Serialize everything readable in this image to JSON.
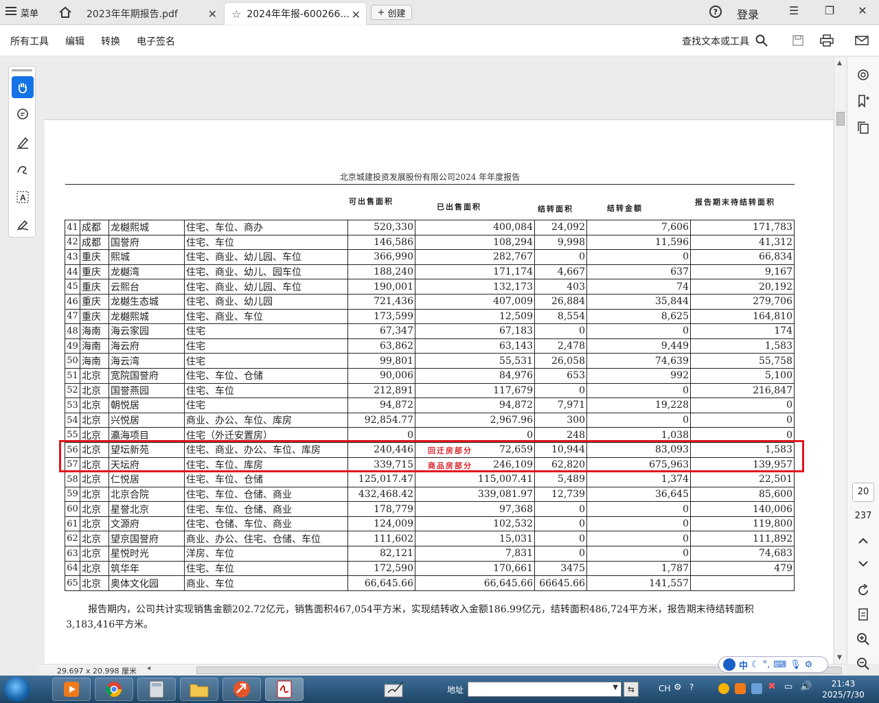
{
  "tabbar": {
    "menu_label": "菜单",
    "tabs": [
      {
        "label": "2023年年期报告.pdf"
      },
      {
        "label": "2024年年报-600266..."
      }
    ],
    "create_label": "创建",
    "login_label": "登录"
  },
  "toolbar": {
    "items": [
      "所有工具",
      "编辑",
      "转换",
      "电子签名"
    ],
    "find_label": "查找文本或工具"
  },
  "document": {
    "header": "北京城建投资发展股份有限公司2024 年年度报告",
    "columns": {
      "avail": "可出售面积",
      "sold": "已出售面积",
      "carry_area": "结转面积",
      "carry_amount": "结转金额",
      "end_area": "报告期末待结转面积"
    },
    "rows": [
      {
        "idx": "41",
        "city": "成都",
        "name": "龙樾熙城",
        "type": "住宅、车位、商办",
        "avail": "520,330",
        "sold": "400,084",
        "carea": "24,092",
        "camt": "7,606",
        "end": "171,783",
        "note": ""
      },
      {
        "idx": "42",
        "city": "成都",
        "name": "国誉府",
        "type": "住宅、车位",
        "avail": "146,586",
        "sold": "108,294",
        "carea": "9,998",
        "camt": "11,596",
        "end": "41,312",
        "note": ""
      },
      {
        "idx": "43",
        "city": "重庆",
        "name": "熙城",
        "type": "住宅、商业、幼儿园、车位",
        "avail": "366,990",
        "sold": "282,767",
        "carea": "0",
        "camt": "0",
        "end": "66,834",
        "note": ""
      },
      {
        "idx": "44",
        "city": "重庆",
        "name": "龙樾湾",
        "type": "住宅、商业、幼儿、园车位",
        "avail": "188,240",
        "sold": "171,174",
        "carea": "4,667",
        "camt": "637",
        "end": "9,167",
        "note": ""
      },
      {
        "idx": "45",
        "city": "重庆",
        "name": "云熙台",
        "type": "住宅、商业、幼儿园、车位",
        "avail": "190,001",
        "sold": "132,173",
        "carea": "403",
        "camt": "74",
        "end": "20,192",
        "note": ""
      },
      {
        "idx": "46",
        "city": "重庆",
        "name": "龙樾生态城",
        "type": "住宅、商业、幼儿园",
        "avail": "721,436",
        "sold": "407,009",
        "carea": "26,884",
        "camt": "35,844",
        "end": "279,706",
        "note": ""
      },
      {
        "idx": "47",
        "city": "重庆",
        "name": "龙樾熙城",
        "type": "住宅、商业、车位",
        "avail": "173,599",
        "sold": "12,509",
        "carea": "8,554",
        "camt": "8,625",
        "end": "164,810",
        "note": ""
      },
      {
        "idx": "48",
        "city": "海南",
        "name": "海云家园",
        "type": "住宅",
        "avail": "67,347",
        "sold": "67,183",
        "carea": "0",
        "camt": "0",
        "end": "174",
        "note": ""
      },
      {
        "idx": "49",
        "city": "海南",
        "name": "海云府",
        "type": "住宅",
        "avail": "63,862",
        "sold": "63,143",
        "carea": "2,478",
        "camt": "9,449",
        "end": "1,583",
        "note": ""
      },
      {
        "idx": "50",
        "city": "海南",
        "name": "海云湾",
        "type": "住宅",
        "avail": "99,801",
        "sold": "55,531",
        "carea": "26,058",
        "camt": "74,639",
        "end": "55,758",
        "note": ""
      },
      {
        "idx": "51",
        "city": "北京",
        "name": "宽院国誉府",
        "type": "住宅、车位、仓储",
        "avail": "90,006",
        "sold": "84,976",
        "carea": "653",
        "camt": "992",
        "end": "5,100",
        "note": ""
      },
      {
        "idx": "52",
        "city": "北京",
        "name": "国誉燕园",
        "type": "住宅、车位",
        "avail": "212,891",
        "sold": "117,679",
        "carea": "0",
        "camt": "0",
        "end": "216,847",
        "note": ""
      },
      {
        "idx": "53",
        "city": "北京",
        "name": "朝悦居",
        "type": "住宅",
        "avail": "94,872",
        "sold": "94,872",
        "carea": "7,971",
        "camt": "19,228",
        "end": "0",
        "note": ""
      },
      {
        "idx": "54",
        "city": "北京",
        "name": "兴悦居",
        "type": "商业、办公、车位、库房",
        "avail": "92,854.77",
        "sold": "2,967.96",
        "carea": "300",
        "camt": "0",
        "end": "0",
        "note": ""
      },
      {
        "idx": "55",
        "city": "北京",
        "name": "瀛海项目",
        "type": "住宅（外迁安置房）",
        "avail": "0",
        "sold": "0",
        "carea": "248",
        "camt": "1,038",
        "end": "0",
        "note": ""
      },
      {
        "idx": "56",
        "city": "北京",
        "name": "望坛新苑",
        "type": "住宅、商业、办公、车位、库房",
        "avail": "240,446",
        "sold": "72,659",
        "carea": "10,944",
        "camt": "83,093",
        "end": "1,583",
        "note": "回迁房部分"
      },
      {
        "idx": "57",
        "city": "北京",
        "name": "天坛府",
        "type": "住宅、车位、库房",
        "avail": "339,715",
        "sold": "246,109",
        "carea": "62,820",
        "camt": "675,963",
        "end": "139,957",
        "note": "商品房部分"
      },
      {
        "idx": "58",
        "city": "北京",
        "name": "仁悦居",
        "type": "住宅、车位、仓储",
        "avail": "125,017.47",
        "sold": "115,007.41",
        "carea": "5,489",
        "camt": "1,374",
        "end": "22,501",
        "note": ""
      },
      {
        "idx": "59",
        "city": "北京",
        "name": "北京合院",
        "type": "住宅、车位、仓储、商业",
        "avail": "432,468.42",
        "sold": "339,081.97",
        "carea": "12,739",
        "camt": "36,645",
        "end": "85,600",
        "note": ""
      },
      {
        "idx": "60",
        "city": "北京",
        "name": "星誉北京",
        "type": "住宅、车位、仓储、商业",
        "avail": "178,779",
        "sold": "97,368",
        "carea": "0",
        "camt": "0",
        "end": "140,006",
        "note": ""
      },
      {
        "idx": "61",
        "city": "北京",
        "name": "文源府",
        "type": "住宅、仓储、车位、商业",
        "avail": "124,009",
        "sold": "102,532",
        "carea": "0",
        "camt": "0",
        "end": "119,800",
        "note": ""
      },
      {
        "idx": "62",
        "city": "北京",
        "name": "望京国誉府",
        "type": "商业、办公、住宅、仓储、车位",
        "avail": "111,602",
        "sold": "15,031",
        "carea": "0",
        "camt": "0",
        "end": "111,892",
        "note": ""
      },
      {
        "idx": "63",
        "city": "北京",
        "name": "星悦时光",
        "type": "洋房、车位",
        "avail": "82,121",
        "sold": "7,831",
        "carea": "0",
        "camt": "0",
        "end": "74,683",
        "note": ""
      },
      {
        "idx": "64",
        "city": "北京",
        "name": "筑华年",
        "type": "住宅、车位",
        "avail": "172,590",
        "sold": "170,661",
        "carea": "3475",
        "camt": "1,787",
        "end": "479",
        "note": ""
      },
      {
        "idx": "65",
        "city": "北京",
        "name": "奥体文化园",
        "type": "商业、车位",
        "avail": "66,645.66",
        "sold": "66,645.66",
        "carea": "66645.66",
        "camt": "141,557",
        "end": "",
        "note": ""
      }
    ],
    "summary": "报告期内，公司共计实现销售金额202.72亿元，销售面积467,054平方米，实现结转收入金额186.99亿元，结转面积486,724平方米，报告期末待结转面积3,183,416平方米。"
  },
  "navigation": {
    "current_page": "20",
    "total_pages": "237"
  },
  "statusbar": {
    "page_dims": "29.697 x 20.998 厘米"
  },
  "taskbar": {
    "address_label": "地址",
    "tray_lang": "CH",
    "clock_time": "21:43",
    "clock_date": "2025/7/30"
  },
  "colors": {
    "highlight_border": "#e0151f",
    "annotation_text": "#d9252d",
    "active_tool": "#1473e6"
  }
}
